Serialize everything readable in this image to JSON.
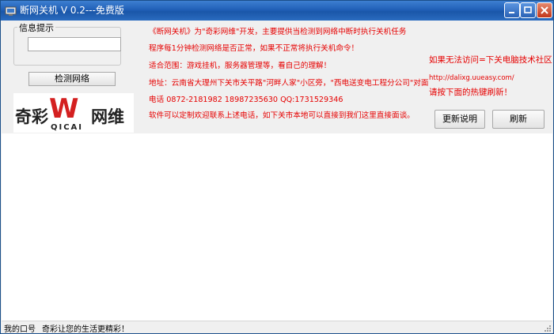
{
  "window": {
    "title": "断网关机 V 0.2---免费版"
  },
  "info_group": {
    "label": "信息提示",
    "value": ""
  },
  "check_button": {
    "label": "检测网络"
  },
  "logo": {
    "left": "奇彩",
    "center": "W",
    "sub": "QICAI",
    "right": "网维",
    "colors": {
      "text": "#222222",
      "accent": "#d42020"
    }
  },
  "notice": {
    "lines": [
      "《断网关机》为\"奇彩网维\"开发，主要提供当检测到网络中断时执行关机任务",
      "程序每1分钟检测网络是否正常，如果不正常将执行关机命令！",
      "适合范围：游戏挂机，服务器管理等，看自己的理解！",
      "地址：云南省大理州下关市关平路\"河畔人家\"小区旁，\"西电送变电工程分公司\"对面",
      "电话 0872-2181982 18987235630  QQ:1731529346",
      "软件可以定制欢迎联系上述电话，如下关市本地可以直接到我们这里直接面谈。"
    ],
    "color": "#e60000"
  },
  "right_panel": {
    "title": "如果无法访问=下关电脑技术社区",
    "url": "http://dalixg.uueasy.com/",
    "hint": "请按下面的热键刷新！"
  },
  "buttons": {
    "update": "更新说明",
    "refresh": "刷新"
  },
  "statusbar": {
    "label": "我的口号",
    "message": "奇彩让您的生活更精彩！"
  }
}
